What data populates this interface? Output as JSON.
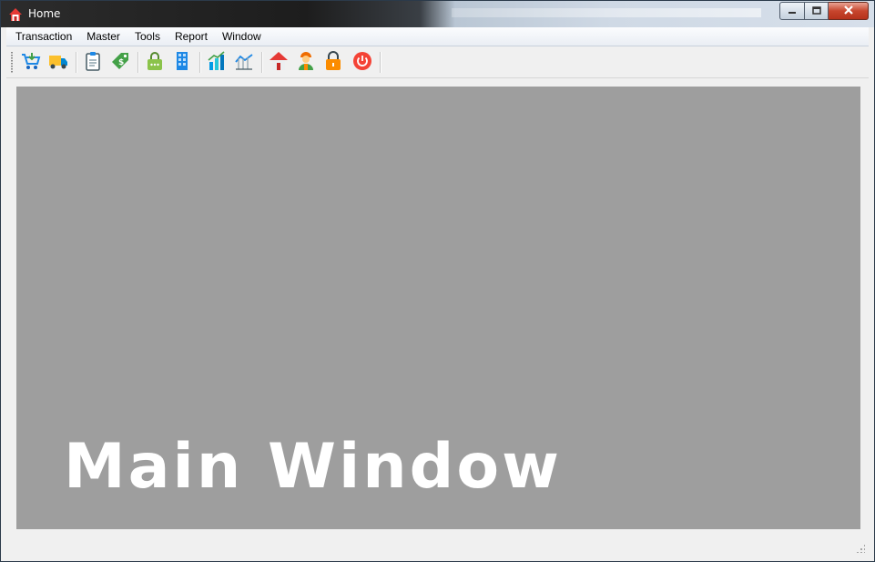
{
  "window": {
    "title": "Home",
    "controls": {
      "minimize_icon": "minimize-icon",
      "maximize_icon": "restore-icon",
      "close_icon": "close-icon"
    }
  },
  "menu": {
    "items": [
      {
        "label": "Transaction"
      },
      {
        "label": "Master"
      },
      {
        "label": "Tools"
      },
      {
        "label": "Report"
      },
      {
        "label": "Window"
      }
    ]
  },
  "toolbar": {
    "buttons": [
      {
        "icon": "shopping-cart-icon",
        "color": "#1e88e5"
      },
      {
        "icon": "delivery-truck-icon",
        "color": "#f9a825"
      },
      {
        "icon": "clipboard-icon",
        "color": "#455a64"
      },
      {
        "icon": "price-tag-icon",
        "color": "#43a047"
      },
      {
        "icon": "bag-icon",
        "color": "#8bc34a"
      },
      {
        "icon": "building-icon",
        "color": "#1e88e5"
      },
      {
        "icon": "bar-chart-icon",
        "color": "#039be5"
      },
      {
        "icon": "line-chart-icon",
        "color": "#1e88e5"
      },
      {
        "icon": "home-icon",
        "color": "#e53935"
      },
      {
        "icon": "user-icon",
        "color": "#ef6c00"
      },
      {
        "icon": "lock-icon",
        "color": "#fb8c00"
      },
      {
        "icon": "power-icon",
        "color": "#f44336"
      }
    ]
  },
  "main": {
    "label": "Main Window",
    "background": "#9e9e9e"
  }
}
